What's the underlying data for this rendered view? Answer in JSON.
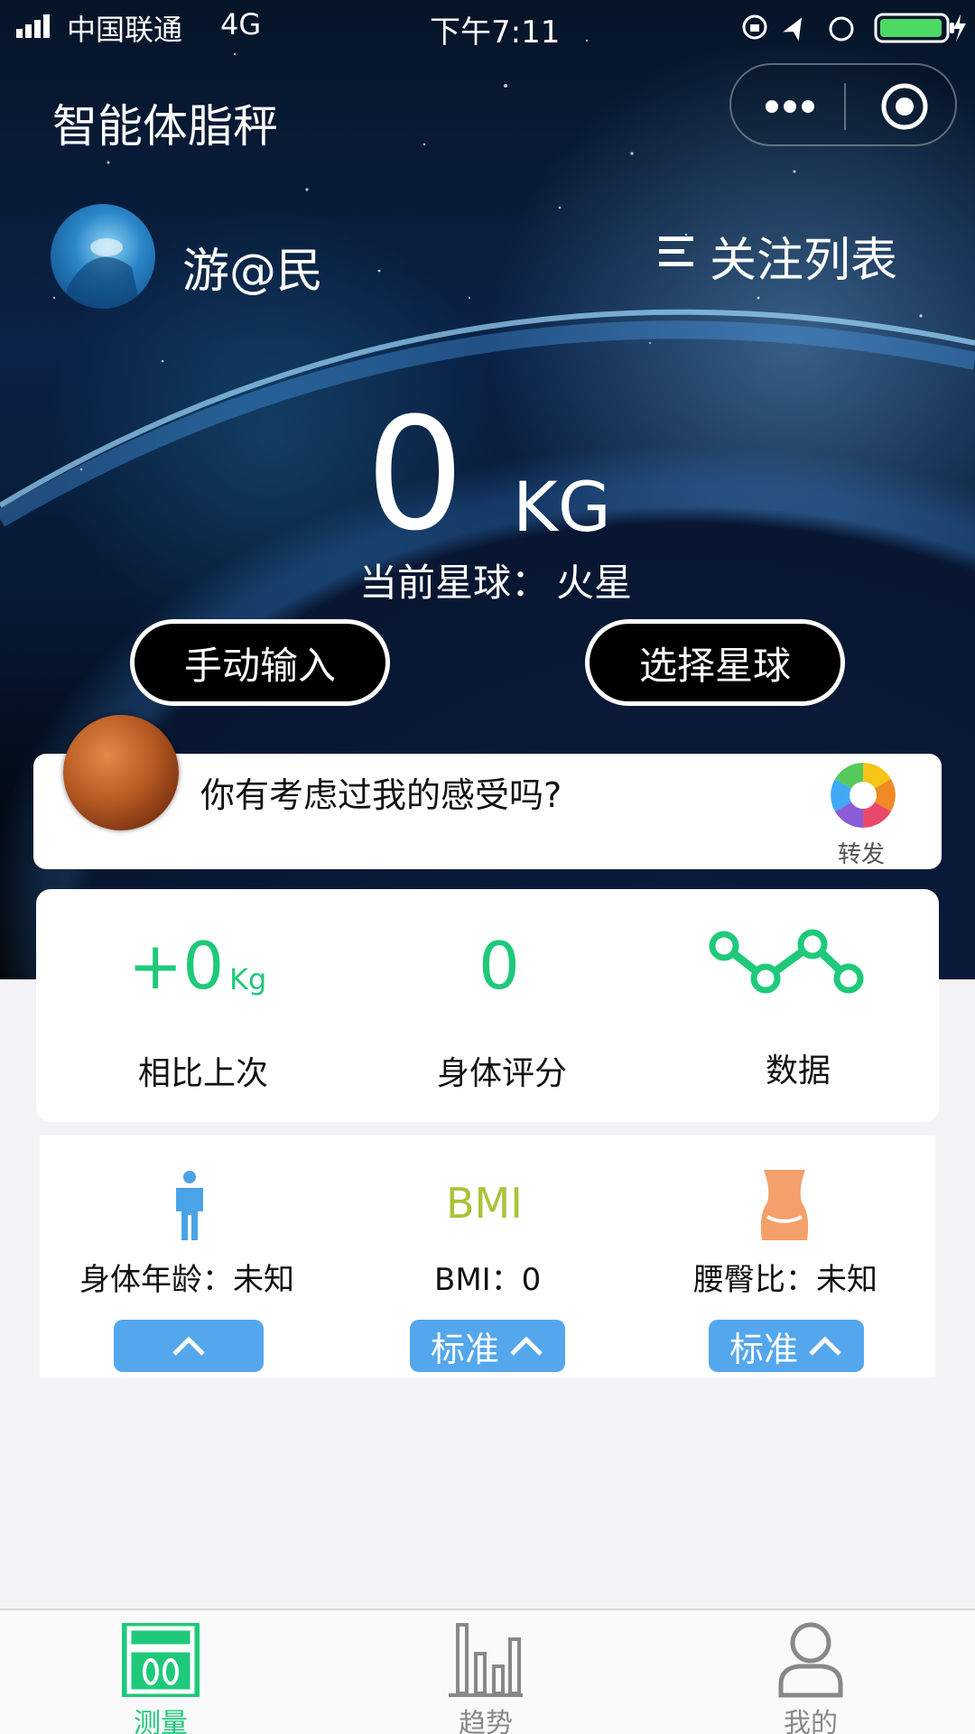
{
  "status_bar": {
    "carrier": "中国联通",
    "network": "4G",
    "time": "下午7:11",
    "battery_color": "#4cd964"
  },
  "nav": {
    "title": "智能体脂秤",
    "icons": [
      "more-icon",
      "close-icon"
    ]
  },
  "user": {
    "name": "游@民",
    "follow_label": "关注列表"
  },
  "weight": {
    "value": "0",
    "unit": "KG",
    "planet_label": "当前星球：",
    "planet_value": "火星"
  },
  "buttons": {
    "manual_input": "手动输入",
    "select_planet": "选择星球"
  },
  "message": {
    "text": "你有考虑过我的感受吗?",
    "share_label": "转发"
  },
  "stats": {
    "change_value": "+0",
    "change_unit": "Kg",
    "change_label": "相比上次",
    "score_value": "0",
    "score_label": "身体评分",
    "data_label": "数据"
  },
  "metrics": {
    "body_age_label": "身体年龄：未知",
    "bmi_icon_text": "BMI",
    "bmi_label": "BMI：0",
    "bmi_status": "标准",
    "whr_label": "腰臀比：未知",
    "whr_status": "标准"
  },
  "tabs": [
    {
      "label": "测量",
      "icon": "scale-icon",
      "active": true
    },
    {
      "label": "趋势",
      "icon": "bar-chart-icon",
      "active": false
    },
    {
      "label": "我的",
      "icon": "user-icon",
      "active": false
    }
  ],
  "colors": {
    "accent_green": "#1fc97a",
    "button_blue": "#54a7ec",
    "bmi_olive": "#a8c43a",
    "waist_orange": "#f4a06a",
    "body_blue": "#4aa3e6"
  }
}
